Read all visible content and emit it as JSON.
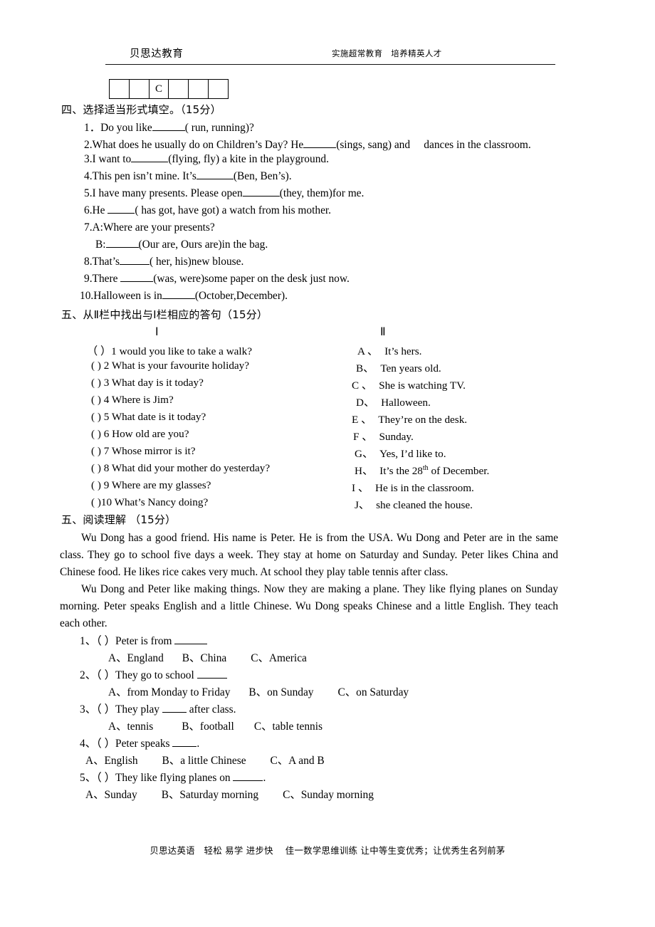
{
  "header": {
    "logo_text": "贝思达教育",
    "slogan": "实施超常教育　培养精英人才"
  },
  "answer_grid": {
    "cells": [
      "",
      "",
      "C",
      "",
      "",
      ""
    ]
  },
  "section_fill": {
    "heading": "四、选择适当形式填空。（15分）",
    "items": [
      {
        "num": "1．",
        "pre": "Do you like",
        "post": "( run, running)?",
        "blank": "w46"
      },
      {
        "num": "2.",
        "pre": "What does he usually do on Children’s Day? He",
        "post": "(sings, sang) and　 dances in the classroom.",
        "blank": "w46"
      },
      {
        "num": "3.",
        "pre": "I want to",
        "post": "(flying, fly) a kite in the playground.",
        "blank": "w52"
      },
      {
        "num": "4.",
        "pre": "This pen isn’t mine. It’s",
        "post": "(Ben, Ben’s).",
        "blank": "w52"
      },
      {
        "num": "5.",
        "pre": "I have many presents. Please open",
        "post": "(they, them)for me.",
        "blank": "w52"
      },
      {
        "num": "6.",
        "pre": "He ",
        "post": "( has got, have got) a watch from his mother.",
        "blank": "w38"
      },
      {
        "num": "7.",
        "pre": "A:Where are your presents?",
        "post": "",
        "blank": ""
      },
      {
        "num": "",
        "pre": "B:",
        "post": "(Our are, Ours are)in the bag.",
        "blank": "w46"
      },
      {
        "num": "8.",
        "pre": "That’s",
        "post": "( her, his)new blouse.",
        "blank": "w42"
      },
      {
        "num": "9.",
        "pre": "There ",
        "post": "(was, were)some paper on the desk just now.",
        "blank": "w46"
      },
      {
        "num": "10.",
        "pre": "Halloween is in",
        "post": "(October,December).",
        "blank": "w46"
      }
    ]
  },
  "section_match": {
    "heading": "五、从Ⅱ栏中找出与Ⅰ栏相应的答句（15分）",
    "col1_head": "Ⅰ",
    "col2_head": "Ⅱ",
    "left": [
      "（ ）1 would   you   like   to   take   a   walk?",
      "( ) 2 What   is   your   favourite   holiday?",
      "( ) 3 What   day   is   it   today?",
      "( ) 4 Where   is   Jim?",
      "( ) 5 What   date   is   it   today?",
      "( ) 6 How   old   are   you?",
      "( ) 7 Whose   mirror   is   it?",
      "( ) 8 What   did   your   mother   do   yesterday?",
      "( ) 9 Where   are   my   glasses?",
      "( )10 What’s   Nancy   doing?"
    ],
    "right": [
      {
        "key": "A 、",
        "text": "It’s hers."
      },
      {
        "key": "B、",
        "text": "Ten years old."
      },
      {
        "key": "C 、",
        "text": "She is watching TV."
      },
      {
        "key": "D、",
        "text": "Halloween."
      },
      {
        "key": "E 、",
        "text": "They’re on the desk."
      },
      {
        "key": "F 、",
        "text": "Sunday."
      },
      {
        "key": "G、",
        "text": "Yes, I’d like to."
      },
      {
        "key": "H、",
        "text": "It’s the 28th of December.",
        "sup_part": "th",
        "pre_sup": "It’s the 28",
        "post_sup": " of December."
      },
      {
        "key": "I 、",
        "text": "He is in the classroom."
      },
      {
        "key": "J、",
        "text": "she cleaned the house."
      }
    ]
  },
  "section_reading": {
    "heading": "五、阅读理解 （15分）",
    "paragraph1": "Wu Dong has a good friend. His name is Peter. He is from the USA. Wu Dong and Peter are in the same class. They go to school five days a week. They stay at home on Saturday and Sunday. Peter likes China and Chinese food. He likes rice cakes very much. At school they play table tennis after class.",
    "paragraph2": "Wu Dong and Peter like making things. Now they are making a plane. They like flying planes on Sunday morning. Peter speaks English and a little Chinese. Wu Dong speaks Chinese and a little English. They teach each other.",
    "questions": [
      {
        "num": "1、",
        "bracket": "（ ）",
        "stem_pre": "Peter is from ",
        "stem_post": "",
        "blank": "w46",
        "options": [
          "A、England",
          "B、China",
          "C、America"
        ]
      },
      {
        "num": "2、",
        "bracket": "（ ）",
        "stem_pre": "They go to school ",
        "stem_post": "",
        "blank": "w42",
        "options": [
          "A、from Monday to Friday",
          "B、on Sunday",
          "C、on Saturday"
        ]
      },
      {
        "num": "3、",
        "bracket": "（ ）",
        "stem_pre": "They play ",
        "stem_post": " after class.",
        "blank": "w34",
        "options": [
          "A、tennis",
          "B、football",
          "C、table tennis"
        ]
      },
      {
        "num": "4、",
        "bracket": "（ ）",
        "stem_pre": "Peter speaks ",
        "stem_post": ".",
        "blank": "w34",
        "options": [
          "A、English",
          "B、a little Chinese",
          "C、A and B"
        ]
      },
      {
        "num": "5、",
        "bracket": "（ ）",
        "stem_pre": "They like flying planes on ",
        "stem_post": ".",
        "blank": "w42",
        "options": [
          "A、Sunday",
          "B、Saturday morning",
          "C、Sunday morning"
        ]
      }
    ]
  },
  "footer": {
    "text": "贝思达英语　轻松 易学 进步快　 佳一数学思维训练 让中等生变优秀；让优秀生名列前茅"
  }
}
